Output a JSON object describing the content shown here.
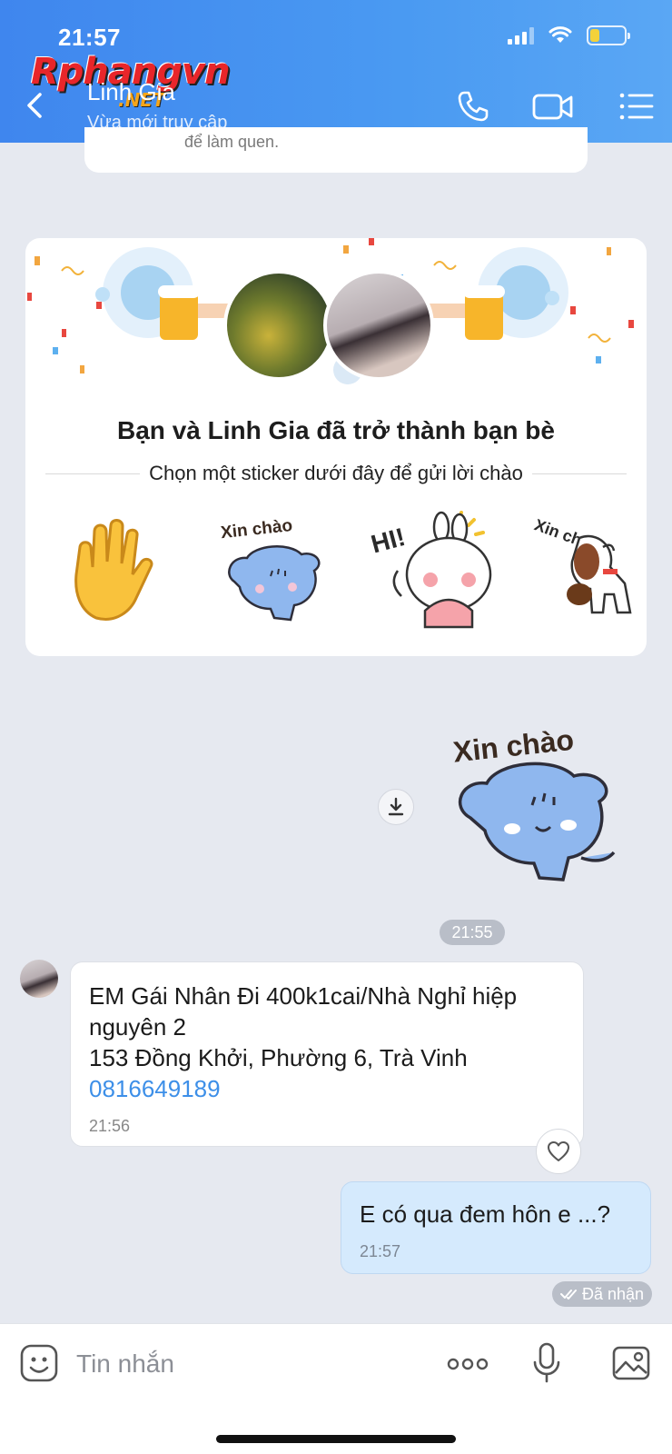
{
  "status_bar": {
    "time": "21:57"
  },
  "watermark": {
    "text": "Rphangvn",
    "suffix": ".NET"
  },
  "header": {
    "contact_name": "Linh Gia",
    "contact_status": "Vừa mới truy cập",
    "icons": [
      "back-icon",
      "phone-icon",
      "video-camera-icon",
      "menu-icon"
    ]
  },
  "previous_card": {
    "text": "để làm quen."
  },
  "friend_card": {
    "title": "Bạn và Linh Gia đã trở thành bạn bè",
    "subtitle": "Chọn một sticker dưới đây để gửi lời chào",
    "stickers": [
      {
        "name": "waving-hand-sticker",
        "text": ""
      },
      {
        "name": "xin-chao-cat-sticker",
        "text": "Xin chào"
      },
      {
        "name": "hi-bunny-sticker",
        "text": "HI!"
      },
      {
        "name": "xin-chao-dog-sticker",
        "text": "Xin chào"
      }
    ]
  },
  "sent_sticker": {
    "text": "Xin chào"
  },
  "time_divider": "21:55",
  "incoming_message": {
    "line1": "EM Gái Nhân Đi 400k1cai/Nhà Nghỉ hiệp nguyên 2",
    "line2": "153 Đồng Khởi, Phường 6, Trà Vinh",
    "phone": "0816649189",
    "time": "21:56"
  },
  "outgoing_message": {
    "text": "E có qua đem hôn e ...?",
    "time": "21:57",
    "status": "Đã nhận"
  },
  "input_bar": {
    "placeholder": "Tin nhắn"
  },
  "colors": {
    "header": "#4a9af2",
    "accent": "#3d8fe8",
    "outgoing_bubble": "#d5eafd",
    "background": "#e6e9f0"
  }
}
